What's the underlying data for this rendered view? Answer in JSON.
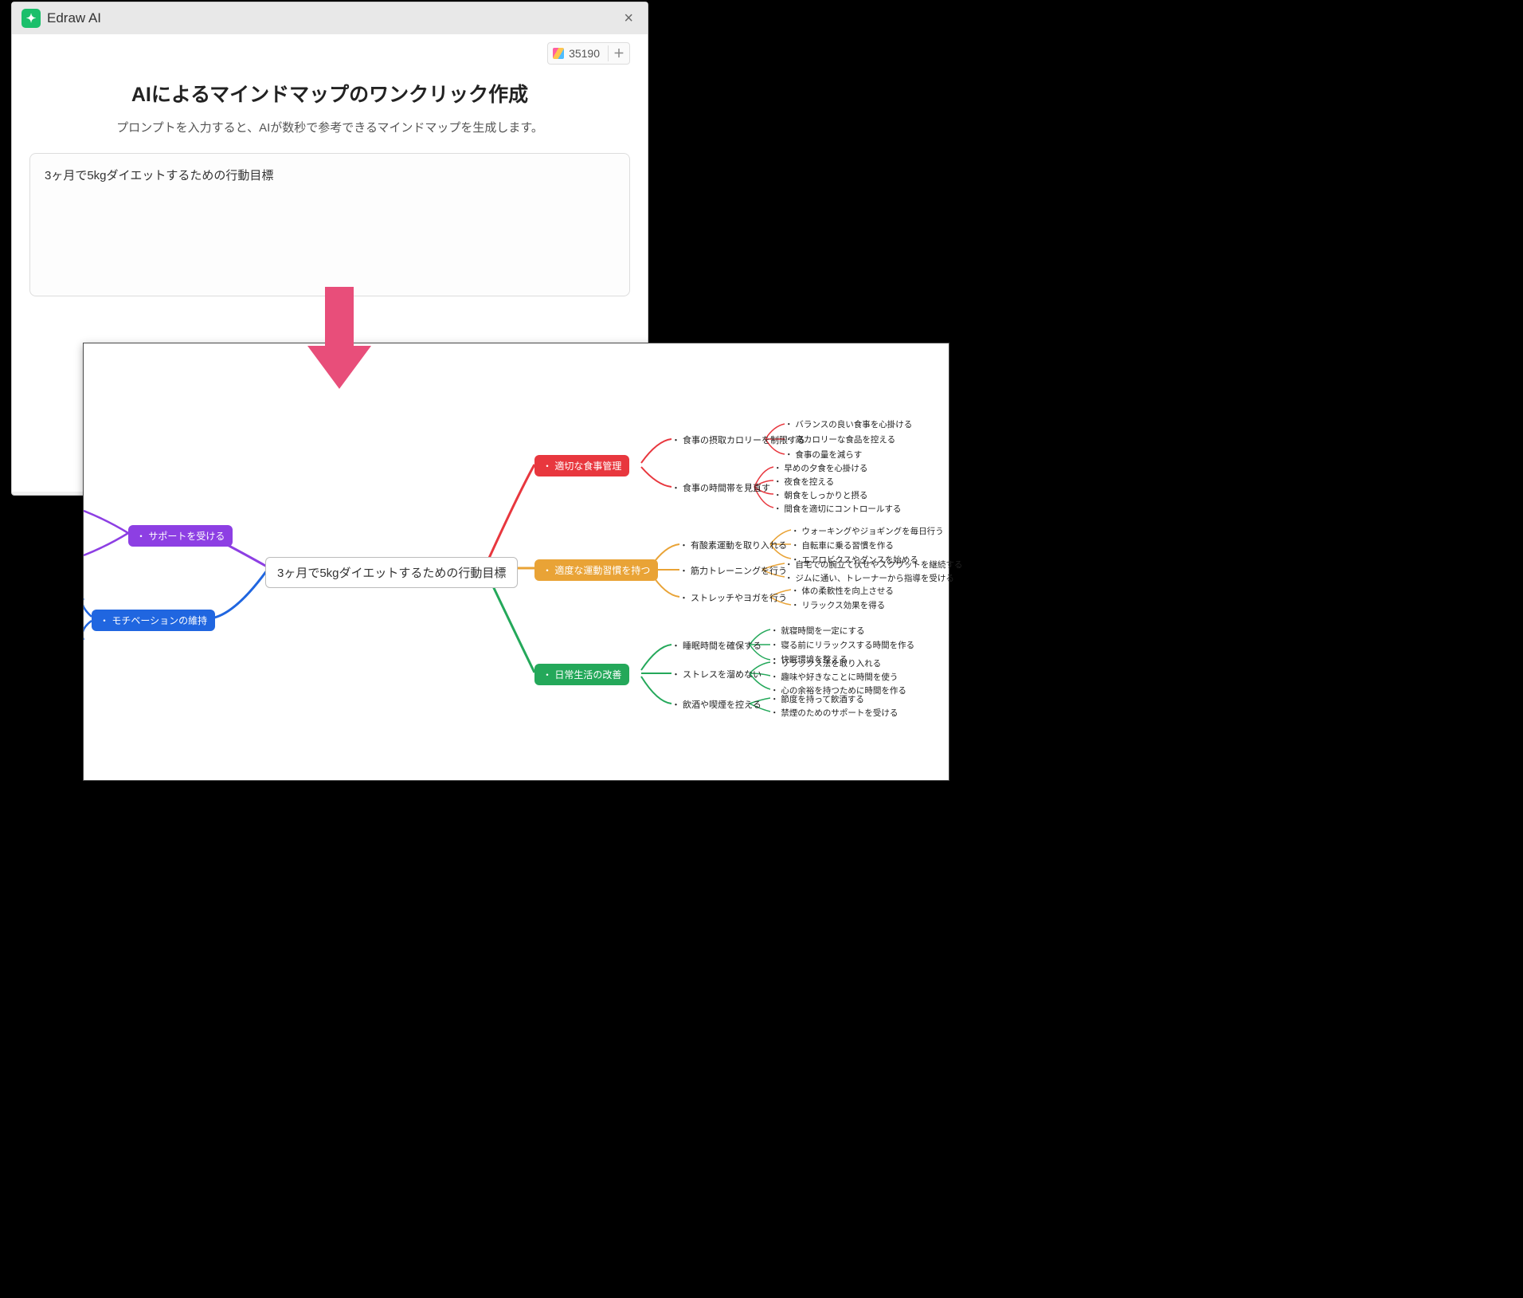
{
  "dialog": {
    "app_name": "Edraw AI",
    "token_count": "35190",
    "heading": "AIによるマインドマップのワンクリック作成",
    "subheading": "プロンプトを入力すると、AIが数秒で参考できるマインドマップを生成します。",
    "prompt_value": "3ヶ月で5kgダイエットするための行動目標"
  },
  "mindmap": {
    "root": "3ヶ月で5kgダイエットするための行動目標",
    "left_branches": {
      "support": "・ サポートを受ける",
      "motivation": "・ モチベーションの維持"
    },
    "right_branches": {
      "diet": {
        "label": "・ 適切な食事管理",
        "subs": {
          "calorie": "・ 食事の摂取カロリーを制限する",
          "timing": "・ 食事の時間帯を見直す"
        },
        "leaves": {
          "c1": "・ バランスの良い食事を心掛ける",
          "c2": "・ 高カロリーな食品を控える",
          "c3": "・ 食事の量を減らす",
          "t1": "・ 早めの夕食を心掛ける",
          "t2": "・ 夜食を控える",
          "t3": "・ 朝食をしっかりと摂る",
          "t4": "・ 間食を適切にコントロールする"
        }
      },
      "exercise": {
        "label": "・ 適度な運動習慣を持つ",
        "subs": {
          "aerobic": "・ 有酸素運動を取り入れる",
          "strength": "・ 筋力トレーニングを行う",
          "stretch": "・ ストレッチやヨガを行う"
        },
        "leaves": {
          "a1": "・ ウォーキングやジョギングを毎日行う",
          "a2": "・ 自転車に乗る習慣を作る",
          "a3": "・ エアロビクスやダンスを始める",
          "s1": "・ 自宅での腕立て伏せやスクワットを継続する",
          "s2": "・ ジムに通い、トレーナーから指導を受ける",
          "y1": "・ 体の柔軟性を向上させる",
          "y2": "・ リラックス効果を得る"
        }
      },
      "life": {
        "label": "・ 日常生活の改善",
        "subs": {
          "sleep": "・ 睡眠時間を確保する",
          "stress": "・ ストレスを溜めない",
          "drink": "・ 飲酒や喫煙を控える"
        },
        "leaves": {
          "sl1": "・ 就寝時間を一定にする",
          "sl2": "・ 寝る前にリラックスする時間を作る",
          "sl3": "・ 快眠環境を整える",
          "st1": "・ リラックス法を取り入れる",
          "st2": "・ 趣味や好きなことに時間を使う",
          "st3": "・ 心の余裕を持つために時間を作る",
          "d1": "・ 節度を持って飲酒する",
          "d2": "・ 禁煙のためのサポートを受ける"
        }
      }
    }
  }
}
